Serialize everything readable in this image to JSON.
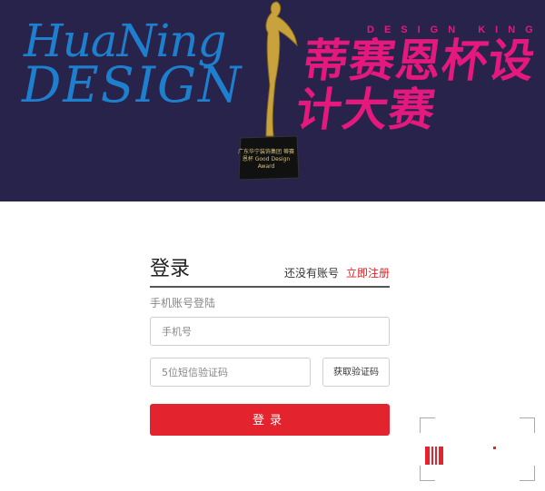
{
  "banner": {
    "brand_line1": "HuaNing",
    "brand_line2": "DESIGN",
    "design_king": "DESIGN KING",
    "event_title": "蒂赛恩杯设计大赛",
    "trophy_caption": "广东华宁装饰集团 蒂赛恩杯 Good Design Award"
  },
  "login": {
    "title": "登录",
    "no_account": "还没有账号",
    "register_link": "立即注册",
    "subtitle": "手机账号登陆",
    "phone_placeholder": "手机号",
    "code_placeholder": "5位短信验证码",
    "get_code_label": "获取验证码",
    "submit_label": "登录"
  },
  "colors": {
    "banner_bg": "#27234a",
    "brand_blue": "#1e7fcf",
    "event_pink": "#e5197d",
    "accent_red": "#e3232d"
  }
}
